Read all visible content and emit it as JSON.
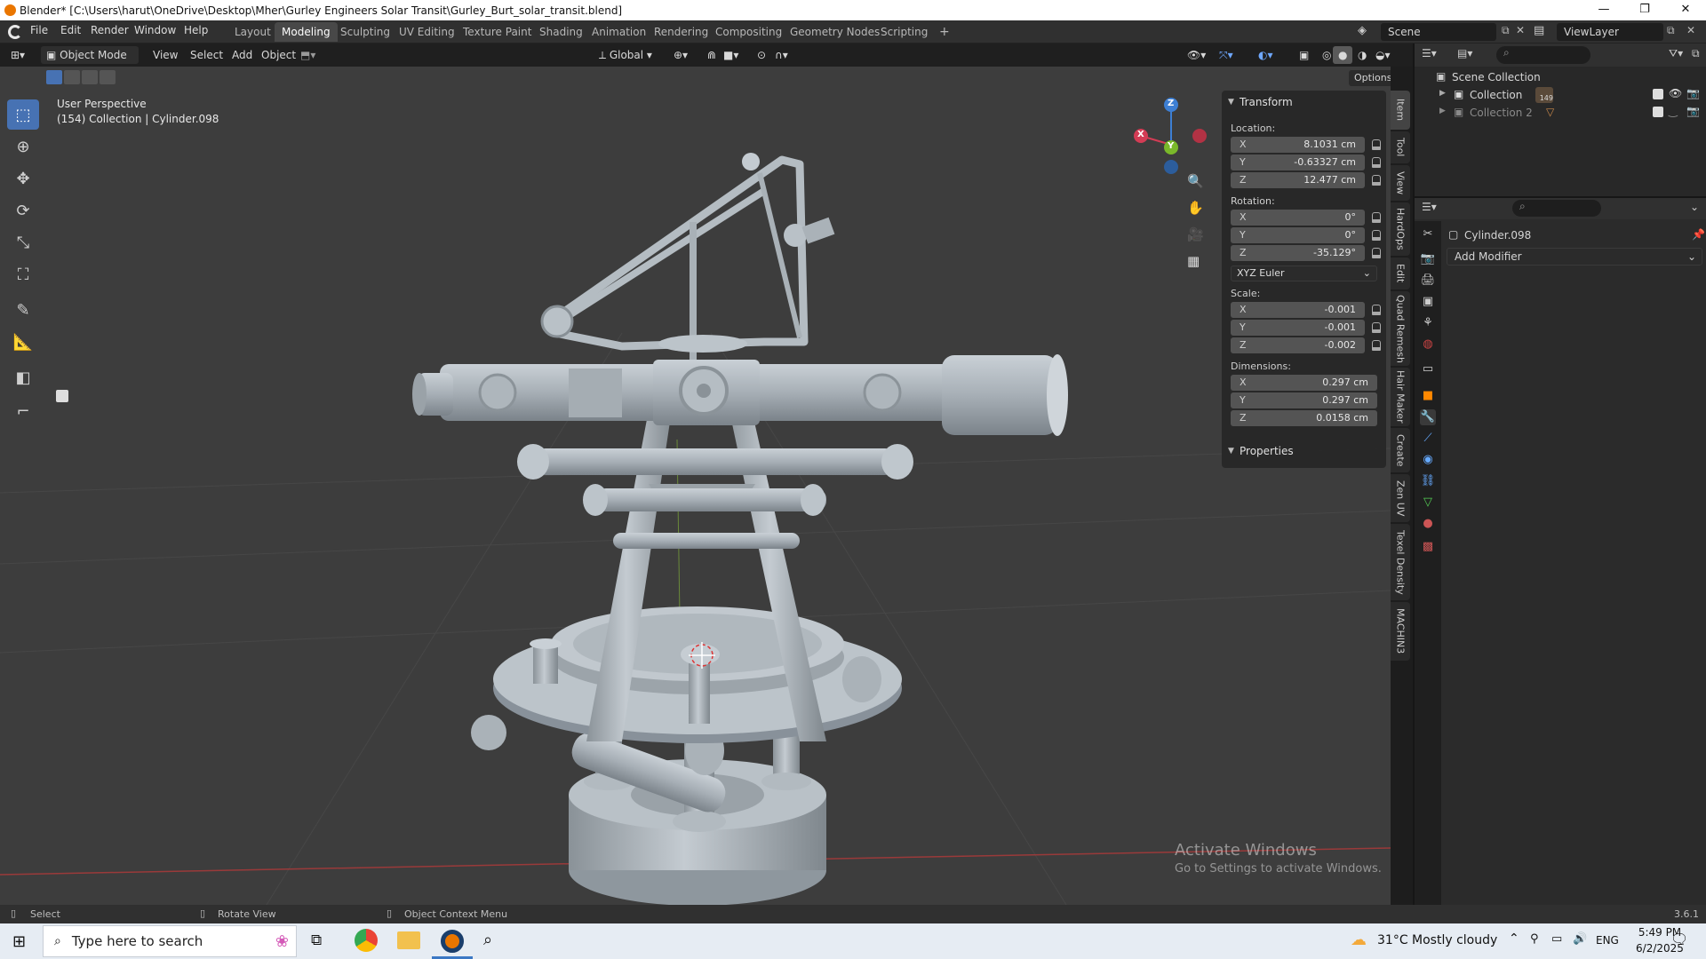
{
  "window": {
    "title": "Blender* [C:\\Users\\harut\\OneDrive\\Desktop\\Mher\\Gurley Engineers Solar Transit\\Gurley_Burt_solar_transit.blend]",
    "minimize": "—",
    "maximize": "❐",
    "close": "✕"
  },
  "menu": {
    "items": [
      "File",
      "Edit",
      "Render",
      "Window",
      "Help"
    ]
  },
  "workspaces": [
    "Layout",
    "Modeling",
    "Sculpting",
    "UV Editing",
    "Texture Paint",
    "Shading",
    "Animation",
    "Rendering",
    "Compositing",
    "Geometry Nodes",
    "Scripting"
  ],
  "active_workspace": "Modeling",
  "add_workspace": "+",
  "scene": {
    "name": "Scene",
    "view_layer": "ViewLayer"
  },
  "viewport_header": {
    "mode": "Object Mode",
    "menus": [
      "View",
      "Select",
      "Add",
      "Object"
    ],
    "orientation": "Global",
    "options": "Options"
  },
  "viewport": {
    "perspective": "User Perspective",
    "info": "(154) Collection | Cylinder.098",
    "gizmo": {
      "x": "X",
      "y": "Y",
      "z": "Z"
    }
  },
  "npanel": {
    "transform_title": "Transform",
    "location_label": "Location:",
    "location": [
      {
        "axis": "X",
        "value": "8.1031 cm"
      },
      {
        "axis": "Y",
        "value": "-0.63327 cm"
      },
      {
        "axis": "Z",
        "value": "12.477 cm"
      }
    ],
    "rotation_label": "Rotation:",
    "rotation": [
      {
        "axis": "X",
        "value": "0°"
      },
      {
        "axis": "Y",
        "value": "0°"
      },
      {
        "axis": "Z",
        "value": "-35.129°"
      }
    ],
    "rotation_mode": "XYZ Euler",
    "scale_label": "Scale:",
    "scale": [
      {
        "axis": "X",
        "value": "-0.001"
      },
      {
        "axis": "Y",
        "value": "-0.001"
      },
      {
        "axis": "Z",
        "value": "-0.002"
      }
    ],
    "dimensions_label": "Dimensions:",
    "dimensions": [
      {
        "axis": "X",
        "value": "0.297 cm"
      },
      {
        "axis": "Y",
        "value": "0.297 cm"
      },
      {
        "axis": "Z",
        "value": "0.0158 cm"
      }
    ],
    "properties_title": "Properties"
  },
  "side_tabs": [
    "Item",
    "Tool",
    "View",
    "HardOps",
    "Edit",
    "Quad Remesh",
    "Hair Maker",
    "Create",
    "Zen UV",
    "Texel Density",
    "MACHIN3"
  ],
  "outliner": {
    "scene_collection": "Scene Collection",
    "rows": [
      {
        "name": "Collection",
        "badge": "149"
      },
      {
        "name": "Collection 2",
        "badge": ""
      }
    ]
  },
  "properties": {
    "object_name": "Cylinder.098",
    "add_modifier": "Add Modifier"
  },
  "watermark": {
    "line1": "Activate Windows",
    "line2": "Go to Settings to activate Windows."
  },
  "statusbar": {
    "select": "Select",
    "rotate": "Rotate View",
    "context": "Object Context Menu",
    "version": "3.6.1"
  },
  "taskbar": {
    "search_placeholder": "Type here to search",
    "weather": "31°C  Mostly cloudy",
    "language": "ENG",
    "time": "5:49 PM",
    "date": "6/2/2025"
  }
}
